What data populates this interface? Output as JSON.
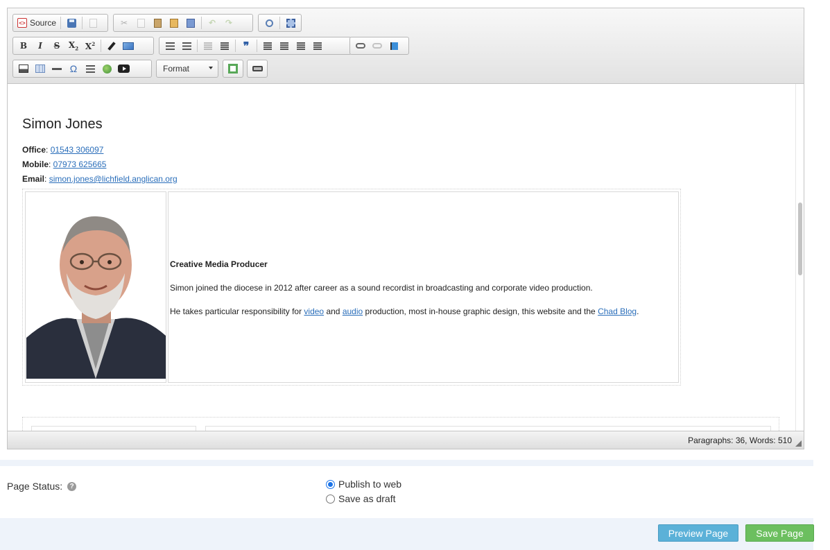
{
  "toolbar": {
    "source_label": "Source",
    "format_label": "Format"
  },
  "content": {
    "name": "Simon Jones",
    "office_label": "Office",
    "office_value": "01543 306097",
    "mobile_label": "Mobile",
    "mobile_value": "07973 625665",
    "email_label": "Email",
    "email_value": "simon.jones@lichfield.anglican.org",
    "role": "Creative Media Producer",
    "para1": "Simon joined the diocese in 2012 after career as a sound recordist in broadcasting and corporate video production.",
    "para2_a": "He takes particular responsibility for ",
    "para2_link1": "video",
    "para2_b": " and ",
    "para2_link2": "audio",
    "para2_c": " production, most in-house graphic design, this website and the ",
    "para2_link3": "Chad Blog",
    "para2_d": "."
  },
  "statusbar": {
    "wordcount": "Paragraphs: 36, Words: 510"
  },
  "form": {
    "status_label": "Page Status:",
    "help_icon": "?",
    "option_publish": "Publish to web",
    "option_draft": "Save as draft",
    "selected": "Publish to web"
  },
  "buttons": {
    "preview": "Preview Page",
    "save": "Save Page"
  },
  "colors": {
    "link": "#2a6eba",
    "preview_button": "#5bb1d8",
    "save_button": "#6cbf5f",
    "page_background": "#eef3fa"
  }
}
